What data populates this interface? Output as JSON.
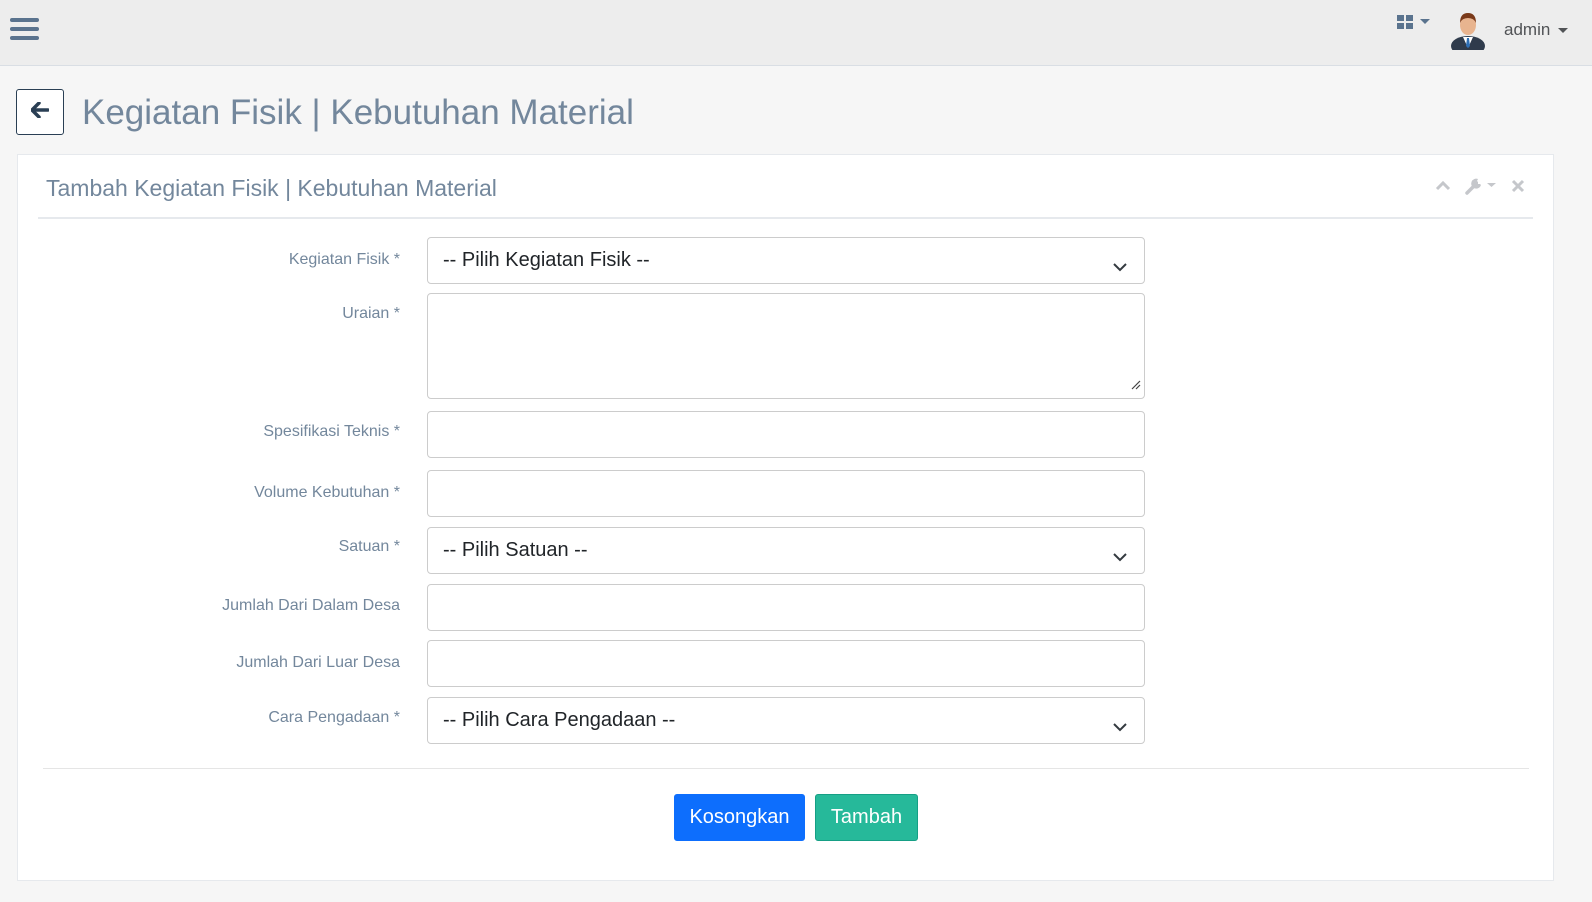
{
  "topbar": {
    "menu_icon": "hamburger-icon",
    "apps_icon": "grid-icon",
    "user_name": "admin"
  },
  "header": {
    "back_icon": "arrow-left-icon",
    "page_title": "Kegiatan Fisik | Kebutuhan Material"
  },
  "panel": {
    "title": "Tambah Kegiatan Fisik | Kebutuhan Material",
    "tools": [
      "chevron-up-icon",
      "wrench-icon",
      "close-icon"
    ]
  },
  "form": {
    "kegiatan_fisik": {
      "label": "Kegiatan Fisik *",
      "value": "-- Pilih Kegiatan Fisik --"
    },
    "uraian": {
      "label": "Uraian *",
      "value": ""
    },
    "spesifikasi_teknis": {
      "label": "Spesifikasi Teknis *",
      "value": ""
    },
    "volume_kebutuhan": {
      "label": "Volume Kebutuhan *",
      "value": ""
    },
    "satuan": {
      "label": "Satuan *",
      "value": "-- Pilih Satuan --"
    },
    "jumlah_dalam_desa": {
      "label": "Jumlah Dari Dalam Desa",
      "value": ""
    },
    "jumlah_luar_desa": {
      "label": "Jumlah Dari Luar Desa",
      "value": ""
    },
    "cara_pengadaan": {
      "label": "Cara Pengadaan *",
      "value": "-- Pilih Cara Pengadaan --"
    }
  },
  "actions": {
    "reset_label": "Kosongkan",
    "submit_label": "Tambah"
  },
  "colors": {
    "primary": "#0d6efd",
    "success": "#26b99a",
    "text": "#73879c",
    "topbar": "#ededed"
  }
}
